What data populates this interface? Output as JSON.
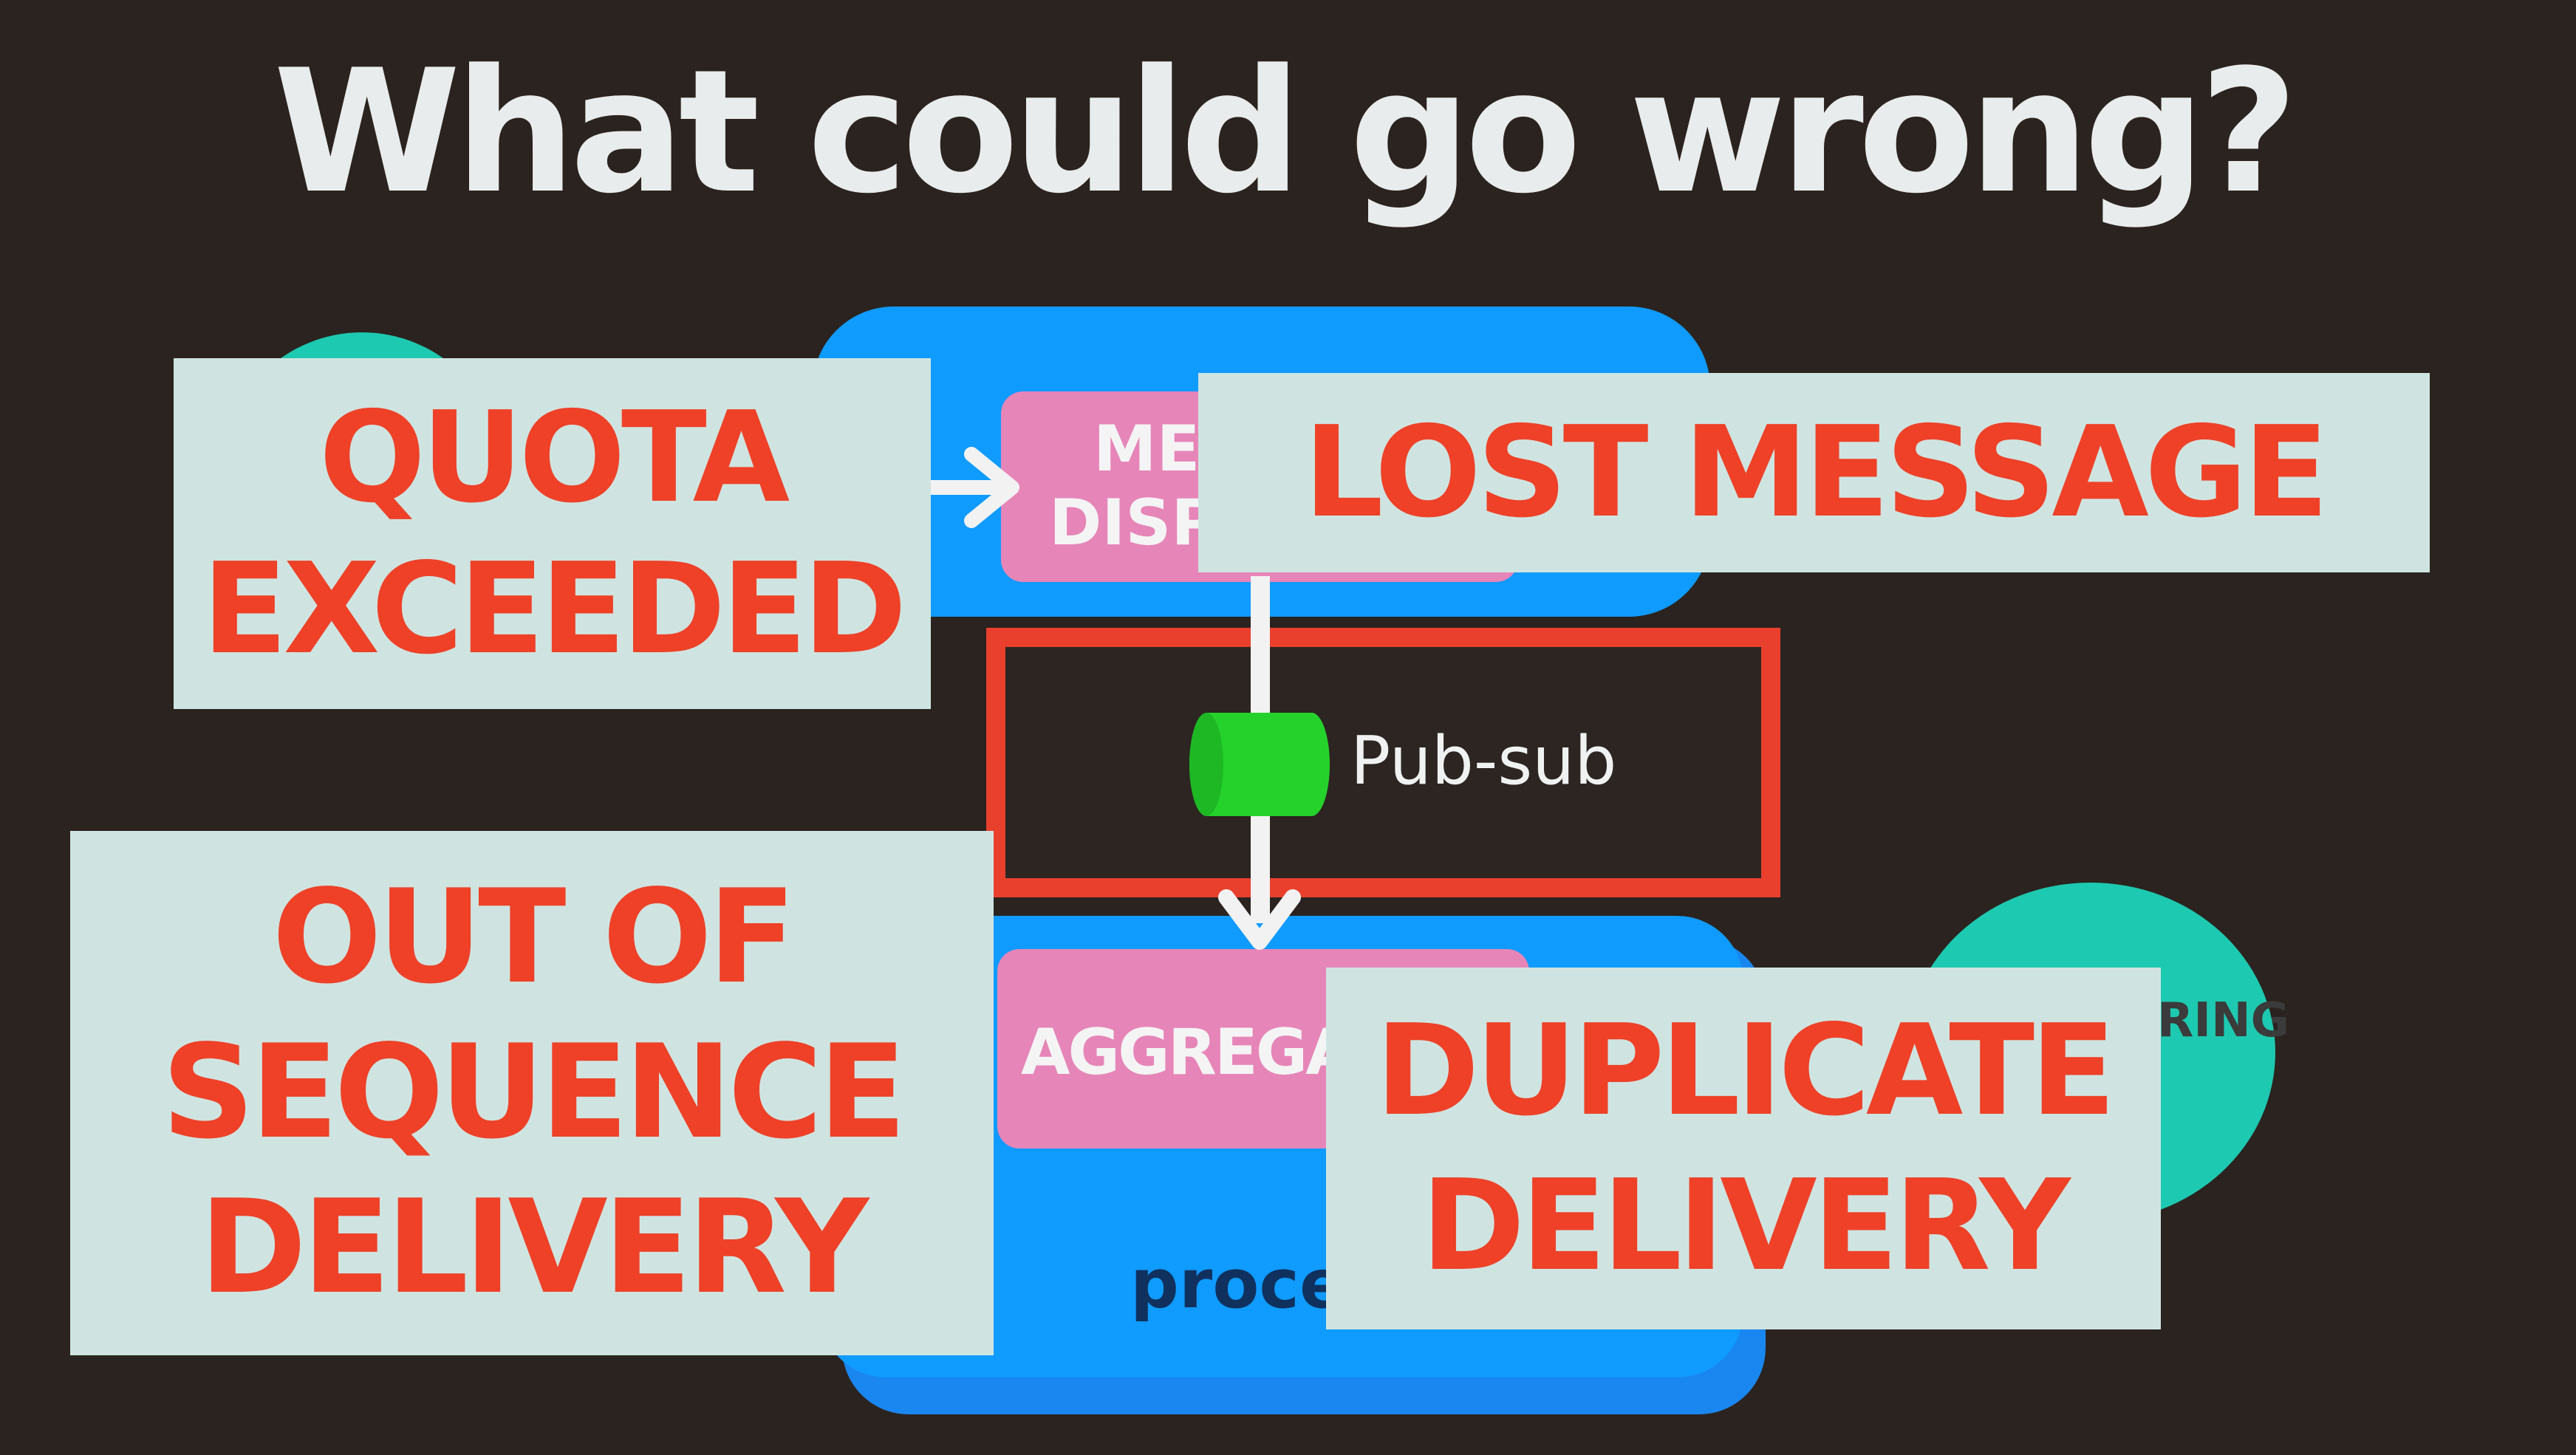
{
  "slide": {
    "title": "What could go wrong?",
    "diagram": {
      "top_component_fragment": [
        "ME",
        "DISP"
      ],
      "queue_label": "Pub-sub",
      "bottom_component_fragment": "AGGREGA",
      "bottom_container_fragment": "proces",
      "right_node_fragment": "RING"
    },
    "cards": {
      "quota": [
        "QUOTA",
        "EXCEEDED"
      ],
      "lost": "LOST MESSAGE",
      "sequence": [
        "OUT OF",
        "SEQUENCE",
        "DELIVERY"
      ],
      "duplicate": [
        "DUPLICATE",
        "DELIVERY"
      ]
    },
    "colors": {
      "background": "#2b231f",
      "title": "#e9ecec",
      "card": "#cfe4e1",
      "card_text": "#ee4128",
      "container_blue": "#0f9bff",
      "component_pink": "#e685b8",
      "node_teal": "#1dc9b0",
      "queue_green": "#25d22b",
      "highlight_red": "#e8402d"
    }
  }
}
